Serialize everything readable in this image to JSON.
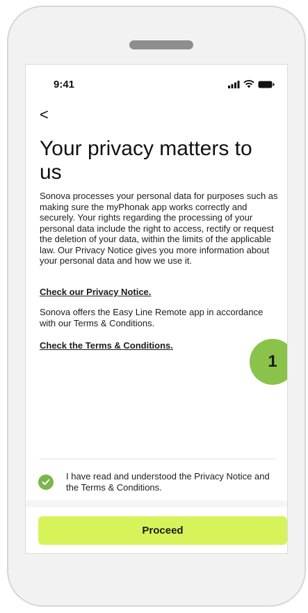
{
  "status_bar": {
    "time": "9:41",
    "icons": [
      "signal-icon",
      "wifi-icon",
      "battery-icon"
    ]
  },
  "nav": {
    "back_icon": "chevron-left-icon",
    "back_glyph": "<"
  },
  "page": {
    "title": "Your privacy matters to us",
    "body": "Sonova processes your personal data for purposes such as making sure the myPhonak app works correctly and securely. Your rights regarding the processing of your personal data include the right to access, rectify or request the deletion of your data, within the limits of the applicable law. Our Privacy Notice gives you more information about your personal data and how we use it.",
    "privacy_link": "Check our Privacy Notice.",
    "terms_body": "Sonova offers the Easy Line Remote app in accordance with our Terms & Conditions.",
    "terms_link": "Check the Terms & Conditions."
  },
  "step_badge": "1",
  "consent": {
    "checked": true,
    "label": "I have read and understood the Privacy Notice and the Terms & Conditions."
  },
  "proceed_label": "Proceed",
  "colors": {
    "accent": "#d6f35a",
    "check": "#7ab648",
    "badge": "#8bc34a"
  }
}
